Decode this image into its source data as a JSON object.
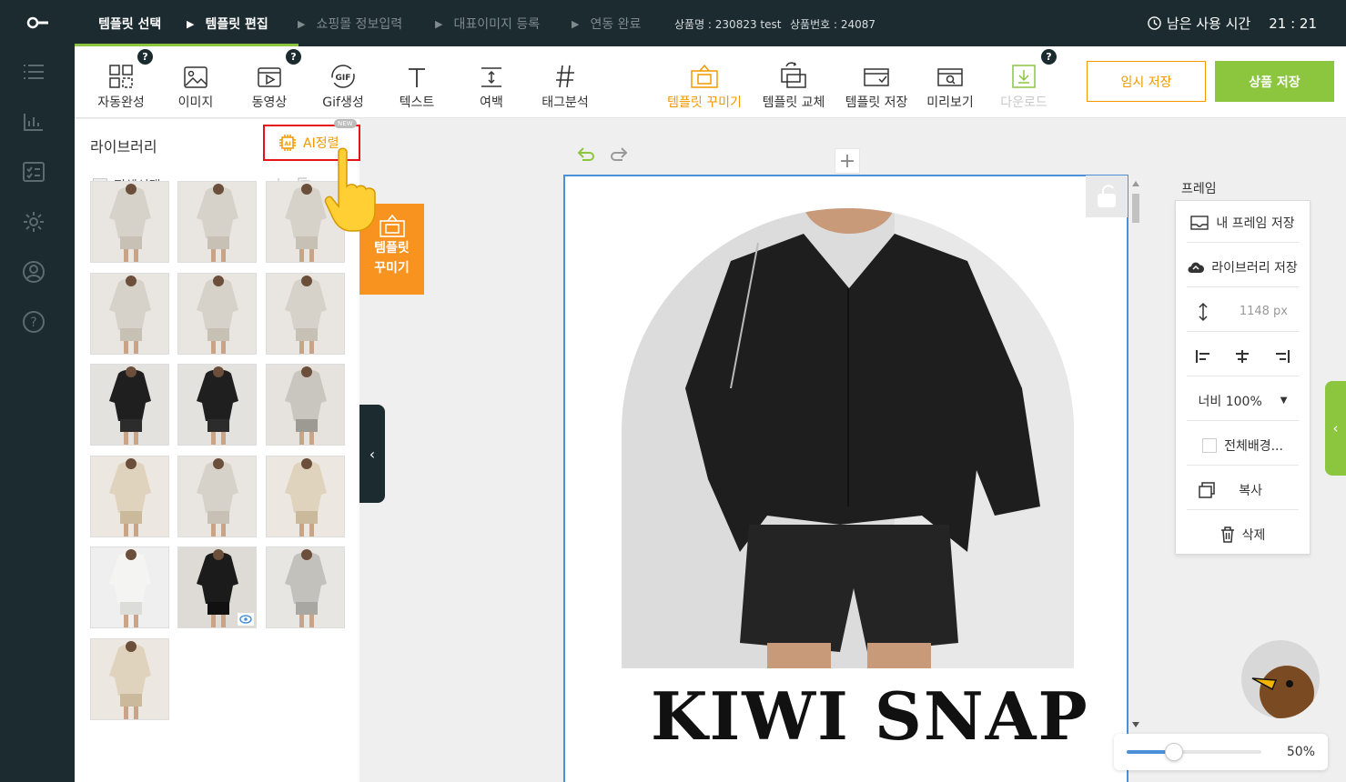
{
  "steps": [
    {
      "label": "템플릿 선택",
      "state": "active"
    },
    {
      "label": "템플릿 편집",
      "state": "active"
    },
    {
      "label": "쇼핑몰 정보입력",
      "state": "inactive"
    },
    {
      "label": "대표이미지 등록",
      "state": "inactive"
    },
    {
      "label": "연동 완료",
      "state": "inactive"
    }
  ],
  "product": {
    "name": "상품명 : 230823 test",
    "number": "상품번호 : 24087"
  },
  "timer": {
    "label": "남은 사용 시간",
    "value": "21 : 21"
  },
  "toolbar": {
    "autocomplete": "자동완성",
    "image": "이미지",
    "video": "동영상",
    "gif": "Gif생성",
    "text": "텍스트",
    "spacing": "여백",
    "tag": "태그분석",
    "decorate": "템플릿 꾸미기",
    "replace": "템플릿 교체",
    "save_template": "템플릿 저장",
    "preview": "미리보기",
    "download": "다운로드",
    "temp_save": "임시 저장",
    "product_save": "상품 저장",
    "help": "?",
    "gif_icon_text": "GIF"
  },
  "library": {
    "title": "라이브러리",
    "ai_button": "AI정렬",
    "ai_badge": "NEW",
    "select_all": "전체선택",
    "thumbnails": [
      "light",
      "light",
      "light",
      "light",
      "light",
      "light",
      "dark",
      "dark",
      "mixed",
      "beige",
      "light",
      "beige",
      "white",
      "black",
      "grey",
      "beige"
    ]
  },
  "popup": {
    "line1": "템플릿",
    "line2": "꾸미기"
  },
  "canvas": {
    "title": "KIWI SNAP"
  },
  "frame": {
    "label": "프레임",
    "my_frame": "내 프레임 저장",
    "library_save": "라이브러리 저장",
    "height": "1148 px",
    "width": "너비 100%",
    "background": "전체배경...",
    "copy": "복사",
    "delete": "삭제"
  },
  "zoom": {
    "value": "50%",
    "level": 0.35
  },
  "colors": {
    "accent_green": "#8cc63f",
    "accent_orange": "#f39800",
    "dark": "#1b2b30",
    "canvas_border": "#4a90d9"
  }
}
